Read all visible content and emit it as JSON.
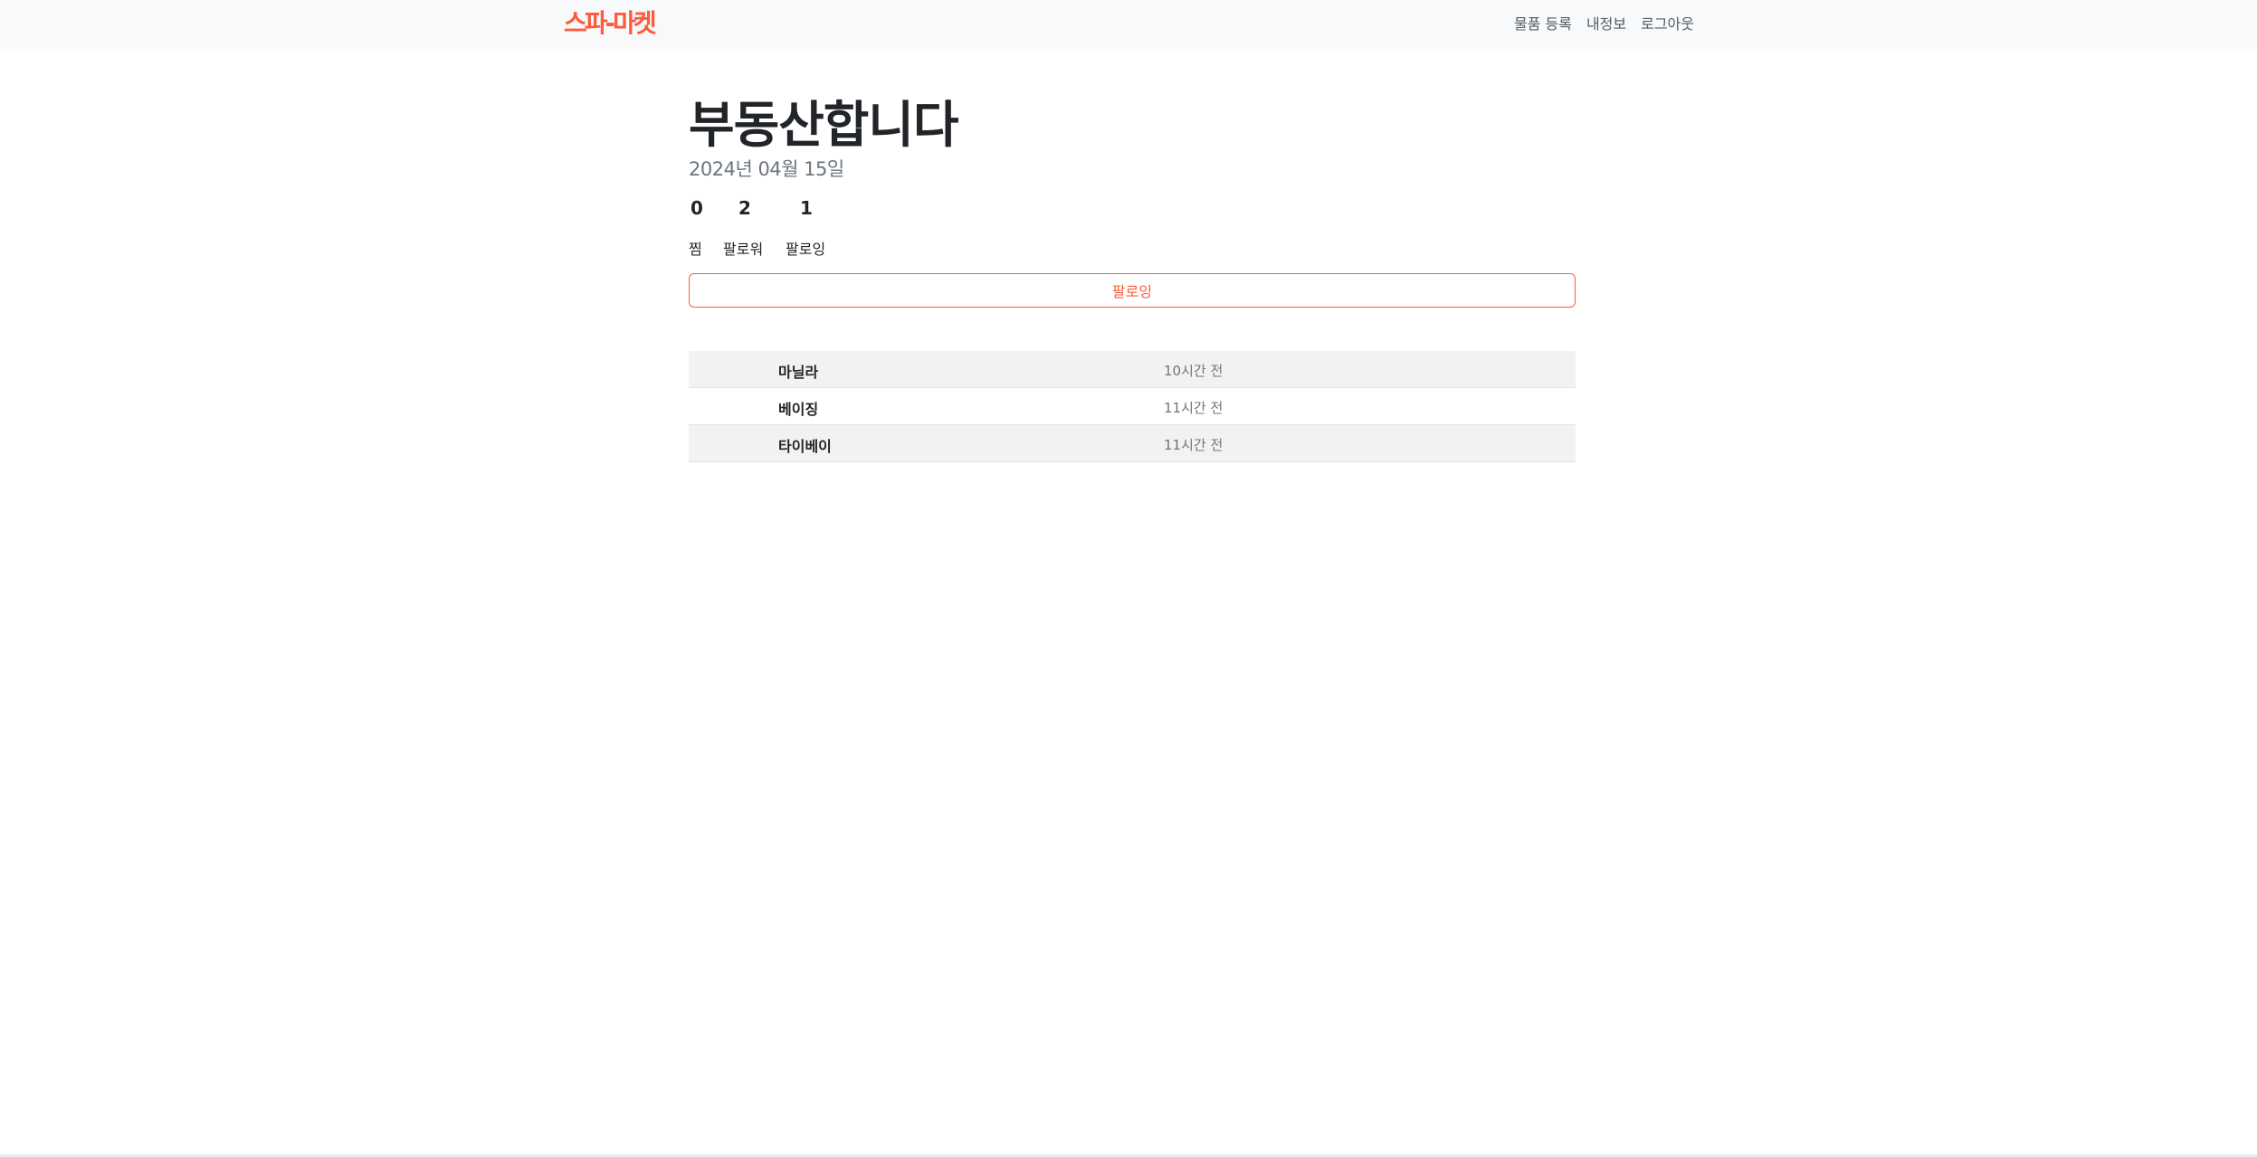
{
  "brand": {
    "logo_text": "스파-마켓",
    "accent_color": "#ff5a3c"
  },
  "nav": {
    "items": [
      {
        "label": "물품 등록"
      },
      {
        "label": "내정보"
      },
      {
        "label": "로그아웃"
      }
    ]
  },
  "profile": {
    "name": "부동산합니다",
    "joined": "2024년 04월 15일",
    "stats": {
      "likes": {
        "value": "0",
        "label": "찜"
      },
      "followers": {
        "value": "2",
        "label": "팔로워"
      },
      "following": {
        "value": "1",
        "label": "팔로잉"
      }
    },
    "follow_button_label": "팔로잉"
  },
  "list": [
    {
      "name": "마닐라",
      "time": "10시간 전"
    },
    {
      "name": "베이징",
      "time": "11시간 전"
    },
    {
      "name": "타이베이",
      "time": "11시간 전"
    }
  ]
}
